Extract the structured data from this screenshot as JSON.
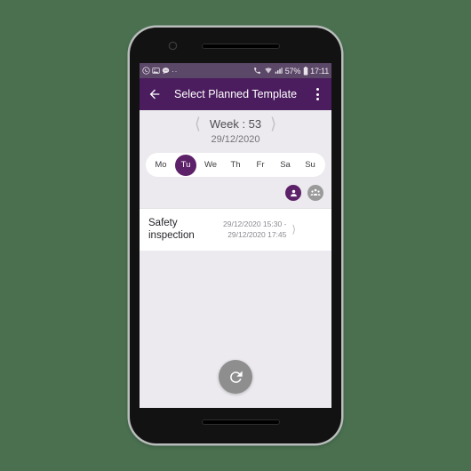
{
  "device": {
    "name": "android-phone",
    "camera_icon": "front-camera",
    "speaker_icon": "earpiece-speaker"
  },
  "status_bar": {
    "left_icons": [
      "whatsapp-icon",
      "photo-icon",
      "message-icon"
    ],
    "overflow_dots": "··",
    "right_icons": [
      "call-icon",
      "wifi-icon",
      "signal-icon",
      "battery-icon"
    ],
    "battery_percent": "57%",
    "time": "17:11",
    "background": "#5b4767"
  },
  "app_bar": {
    "back_icon": "back-arrow-icon",
    "title": "Select Planned Template",
    "overflow_icon": "overflow-menu-icon",
    "background": "#4b1d5e"
  },
  "week_header": {
    "prev_icon": "chevron-left-icon",
    "label": "Week : 53",
    "next_icon": "chevron-right-icon",
    "date": "29/12/2020",
    "background": "#eceaee"
  },
  "weekdays": {
    "items": [
      {
        "label": "Mo",
        "selected": false
      },
      {
        "label": "Tu",
        "selected": true
      },
      {
        "label": "We",
        "selected": false
      },
      {
        "label": "Th",
        "selected": false
      },
      {
        "label": "Fr",
        "selected": false
      },
      {
        "label": "Sa",
        "selected": false
      },
      {
        "label": "Su",
        "selected": false
      }
    ],
    "selected_color": "#5d2169"
  },
  "mode_toggles": [
    {
      "name": "individual",
      "icon": "person-icon",
      "selected": true,
      "color": "#5d2169"
    },
    {
      "name": "group",
      "icon": "people-group-icon",
      "selected": false,
      "color": "#9a9a9a"
    }
  ],
  "template_list": {
    "items": [
      {
        "title": "Safety inspection",
        "time_start": "29/12/2020 15:30 -",
        "time_end": "29/12/2020 17:45",
        "chevron_icon": "chevron-right-icon"
      }
    ]
  },
  "fab": {
    "icon": "refresh-icon",
    "color": "#8e8e8e"
  }
}
